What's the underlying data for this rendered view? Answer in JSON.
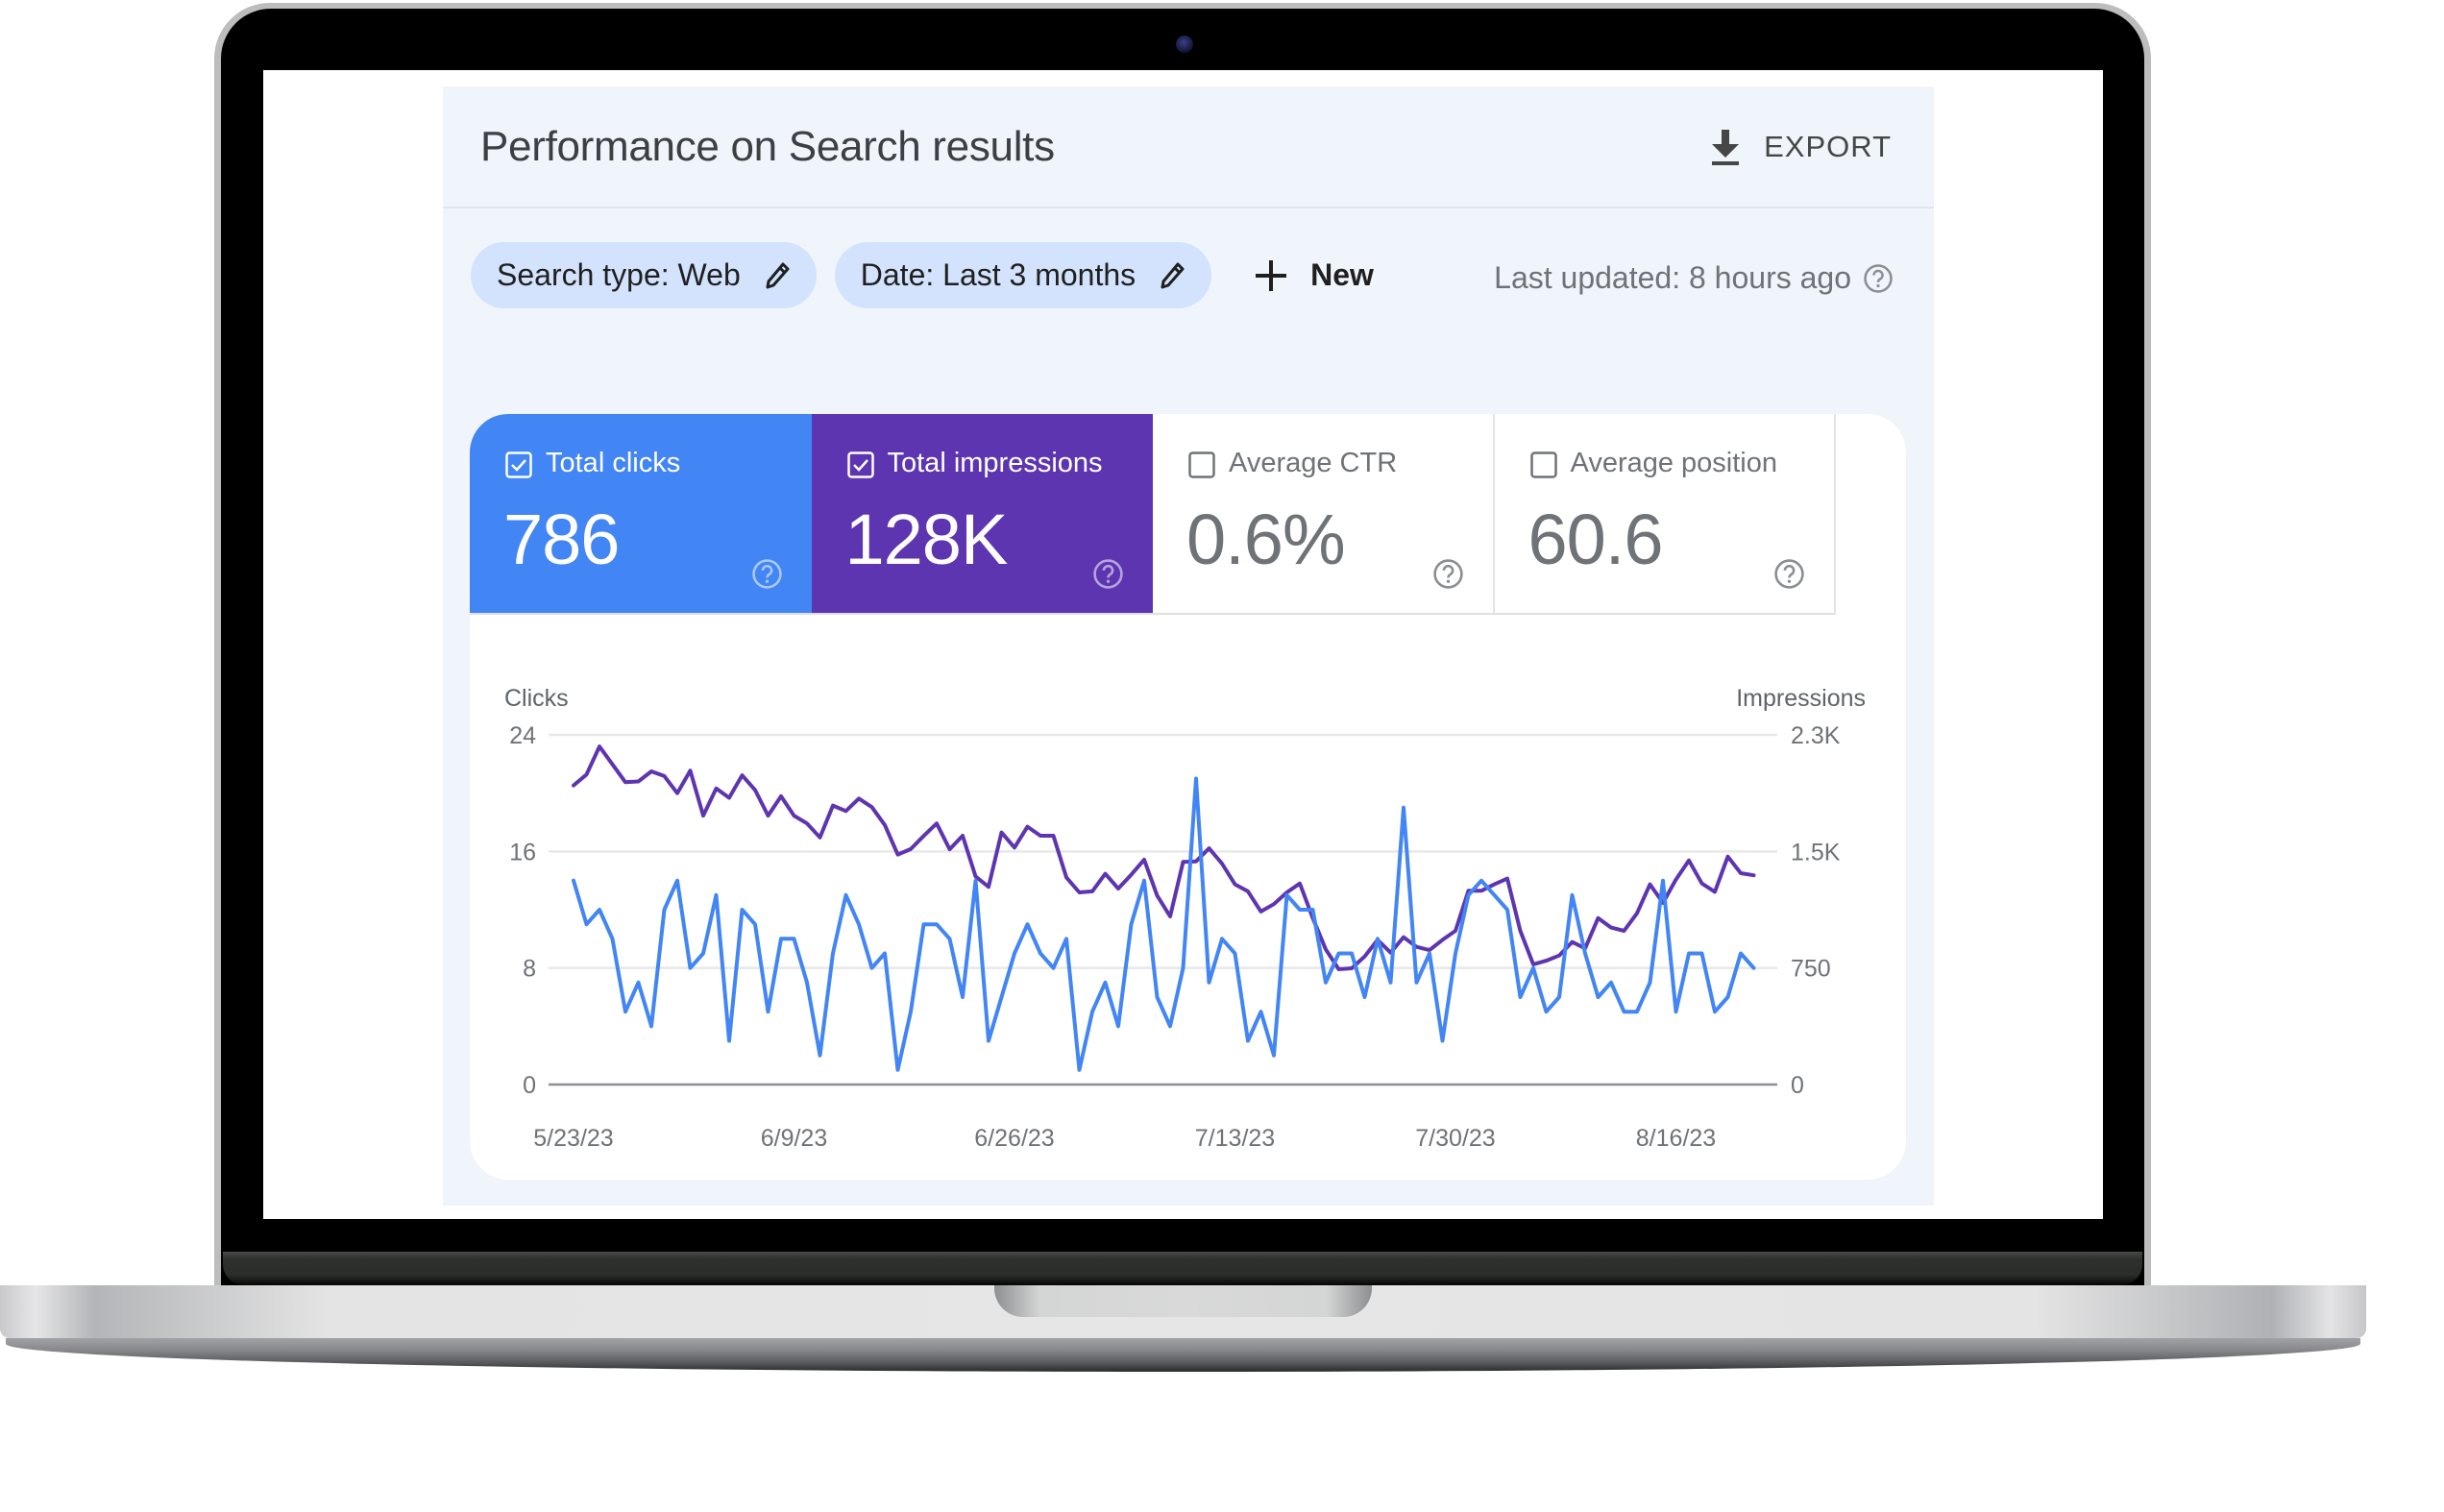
{
  "header": {
    "title": "Performance on Search results",
    "export_label": "EXPORT",
    "export_icon": "download-icon"
  },
  "filters": {
    "chips": [
      {
        "label": "Search type: Web",
        "icon": "edit-pencil-icon"
      },
      {
        "label": "Date: Last 3 months",
        "icon": "edit-pencil-icon"
      }
    ],
    "new_label": "New",
    "new_icon": "plus-icon",
    "last_updated": "Last updated: 8 hours ago",
    "help_icon": "help-circle-icon"
  },
  "metrics": [
    {
      "label": "Total clicks",
      "value": "786",
      "checked": true,
      "color": "#4285f4"
    },
    {
      "label": "Total impressions",
      "value": "128K",
      "checked": true,
      "color": "#5e35b1"
    },
    {
      "label": "Average CTR",
      "value": "0.6%",
      "checked": false
    },
    {
      "label": "Average position",
      "value": "60.6",
      "checked": false
    }
  ],
  "chart_data": {
    "type": "line",
    "title": "",
    "left_axis_title": "Clicks",
    "right_axis_title": "Impressions",
    "left_ticks": [
      "0",
      "8",
      "16",
      "24"
    ],
    "left_ylim": [
      0,
      24
    ],
    "right_ticks": [
      "0",
      "750",
      "1.5K",
      "2.3K"
    ],
    "right_ylim": [
      0,
      2250
    ],
    "x_ticks": [
      {
        "label": "5/23/23",
        "index": 0
      },
      {
        "label": "6/9/23",
        "index": 17
      },
      {
        "label": "6/26/23",
        "index": 34
      },
      {
        "label": "7/13/23",
        "index": 51
      },
      {
        "label": "7/30/23",
        "index": 68
      },
      {
        "label": "8/16/23",
        "index": 85
      }
    ],
    "x_start": "5/23/23",
    "x_end": "8/21/23",
    "grid": true,
    "series": [
      {
        "name": "Clicks",
        "axis": "left",
        "color": "#4285f4",
        "values": [
          14,
          11,
          12,
          10,
          5,
          7,
          4,
          12,
          14,
          8,
          9,
          13,
          3,
          12,
          11,
          5,
          10,
          10,
          7,
          2,
          9,
          13,
          11,
          8,
          9,
          1,
          5,
          11,
          11,
          10,
          6,
          14,
          3,
          6,
          9,
          11,
          9,
          8,
          10,
          1,
          5,
          7,
          4,
          11,
          14,
          6,
          4,
          8,
          21,
          7,
          10,
          9,
          3,
          5,
          2,
          13,
          12,
          12,
          7,
          9,
          9,
          6,
          10,
          7,
          19,
          7,
          9,
          3,
          9,
          13,
          14,
          13,
          12,
          6,
          8,
          5,
          6,
          13,
          9,
          6,
          7,
          5,
          5,
          7,
          14,
          5,
          9,
          9,
          5,
          6,
          9,
          8
        ]
      },
      {
        "name": "Impressions",
        "axis": "right",
        "color": "#5e35b1",
        "values": [
          1925,
          1995,
          2175,
          2060,
          1945,
          1950,
          2015,
          1985,
          1875,
          2020,
          1730,
          1905,
          1845,
          1990,
          1895,
          1730,
          1855,
          1730,
          1680,
          1590,
          1795,
          1760,
          1840,
          1785,
          1670,
          1480,
          1515,
          1600,
          1680,
          1514,
          1601,
          1339,
          1272,
          1622,
          1525,
          1659,
          1601,
          1601,
          1333,
          1236,
          1243,
          1356,
          1261,
          1350,
          1447,
          1216,
          1082,
          1432,
          1436,
          1520,
          1422,
          1288,
          1243,
          1113,
          1161,
          1236,
          1294,
          1071,
          870,
          742,
          748,
          824,
          931,
          849,
          948,
          886,
          865,
          931,
          989,
          1247,
          1247,
          1288,
          1325,
          989,
          773,
          797,
          830,
          917,
          876,
          1071,
          1010,
          989,
          1102,
          1288,
          1169,
          1319,
          1442,
          1294,
          1240,
          1467,
          1360,
          1346
        ]
      }
    ]
  }
}
